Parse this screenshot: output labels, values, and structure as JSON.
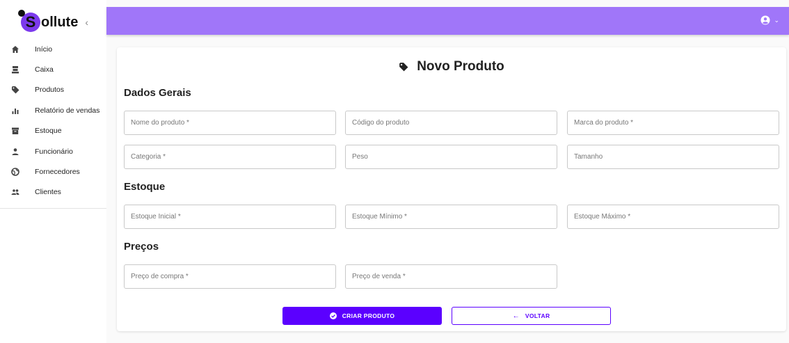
{
  "app": {
    "brand_letter": "S",
    "brand_name": "ollute",
    "collapse_glyph": "‹"
  },
  "sidebar": {
    "items": [
      {
        "label": "Início",
        "icon": "home-icon"
      },
      {
        "label": "Caixa",
        "icon": "cash-register-icon"
      },
      {
        "label": "Produtos",
        "icon": "tag-icon"
      },
      {
        "label": "Relatório de vendas",
        "icon": "bar-chart-icon"
      },
      {
        "label": "Estoque",
        "icon": "archive-icon"
      },
      {
        "label": "Funcionário",
        "icon": "person-icon"
      },
      {
        "label": "Fornecedores",
        "icon": "globe-icon"
      },
      {
        "label": "Clientes",
        "icon": "people-icon"
      }
    ]
  },
  "topbar": {
    "account_icon": "user-circle-icon",
    "caret": "⌄"
  },
  "form": {
    "title": "Novo Produto",
    "sections": {
      "general": "Dados Gerais",
      "stock": "Estoque",
      "prices": "Preços"
    },
    "fields": {
      "nome": {
        "placeholder": "Nome do produto *",
        "value": ""
      },
      "codigo": {
        "placeholder": "Código do produto",
        "value": ""
      },
      "marca": {
        "placeholder": "Marca do produto *",
        "value": ""
      },
      "categoria": {
        "placeholder": "Categoria *",
        "value": ""
      },
      "peso": {
        "placeholder": "Peso",
        "value": ""
      },
      "tamanho": {
        "placeholder": "Tamanho",
        "value": ""
      },
      "estoque_inicial": {
        "placeholder": "Estoque Inicial *",
        "value": ""
      },
      "estoque_minimo": {
        "placeholder": "Estoque Mínimo *",
        "value": ""
      },
      "estoque_maximo": {
        "placeholder": "Estoque Máximo *",
        "value": ""
      },
      "preco_compra": {
        "placeholder": "Preço de compra *",
        "value": ""
      },
      "preco_venda": {
        "placeholder": "Preço de venda *",
        "value": ""
      }
    },
    "buttons": {
      "create": "CRIAR PRODUTO",
      "back": "VOLTAR",
      "back_arrow": "←"
    }
  },
  "colors": {
    "topbar": "#a076f9",
    "primary": "#5b00ff",
    "brand_accent": "#7c3aed"
  }
}
